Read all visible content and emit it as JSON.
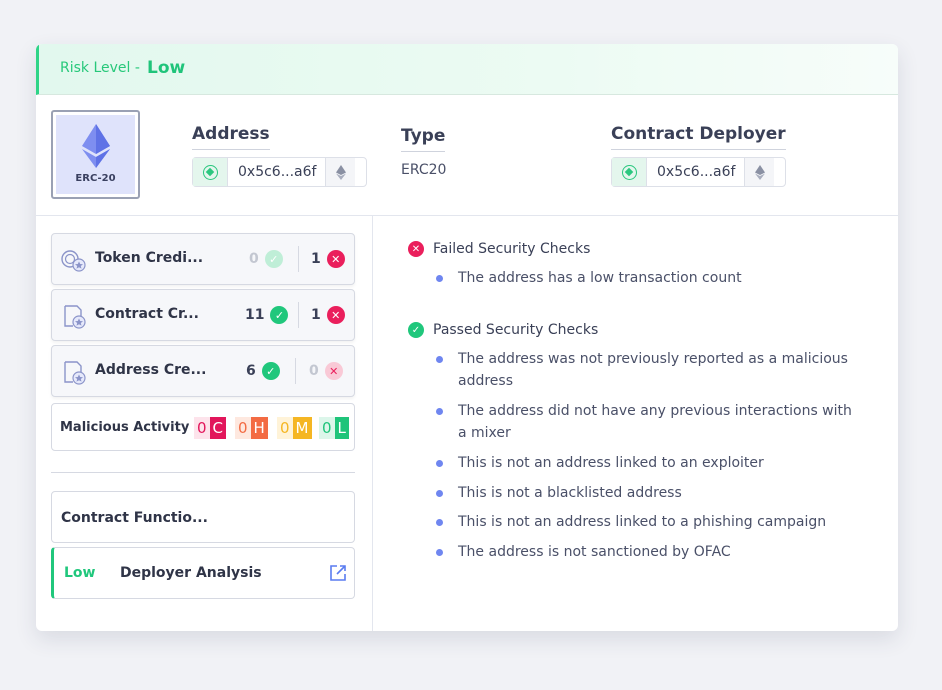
{
  "risk": {
    "label": "Risk Level -",
    "value": "Low"
  },
  "token": {
    "badge": "ERC-20",
    "icon": "ethereum-icon"
  },
  "header": {
    "address": {
      "label": "Address",
      "value": "0x5c6...a6f"
    },
    "type": {
      "label": "Type",
      "value": "ERC20"
    },
    "deployer": {
      "label": "Contract Deployer",
      "value": "0x5c6...a6f"
    }
  },
  "credibility": [
    {
      "name": "Token Credi...",
      "icon": "token-cred-icon",
      "passed": "0",
      "failed": "1"
    },
    {
      "name": "Contract Cr...",
      "icon": "contract-cred-icon",
      "passed": "11",
      "failed": "1"
    },
    {
      "name": "Address Cre...",
      "icon": "address-cred-icon",
      "passed": "6",
      "failed": "0"
    }
  ],
  "malicious": {
    "label": "Malicious Activity",
    "levels": [
      {
        "count": "0",
        "letter": "C",
        "color": "#e2165b"
      },
      {
        "count": "0",
        "letter": "H",
        "color": "#f36b43"
      },
      {
        "count": "0",
        "letter": "M",
        "color": "#f5b623"
      },
      {
        "count": "0",
        "letter": "L",
        "color": "#1fc47a"
      }
    ]
  },
  "contract_functions": {
    "label": "Contract Functio..."
  },
  "deployer_analysis": {
    "level": "Low",
    "label": "Deployer Analysis"
  },
  "checks": {
    "failed_title": "Failed Security Checks",
    "failed": [
      "The address has a low transaction count"
    ],
    "passed_title": "Passed Security Checks",
    "passed": [
      "The address was not previously reported as a malicious address",
      "The address did not have any previous interactions with a mixer",
      "This is not an address linked to an exploiter",
      "This is not a blacklisted address",
      "This is not an address linked to a phishing campaign",
      "The address is not sanctioned by OFAC"
    ]
  },
  "colors": {
    "accent_green": "#20c77c",
    "danger_red": "#ea1f5c",
    "bullet_blue": "#6f86f0"
  }
}
